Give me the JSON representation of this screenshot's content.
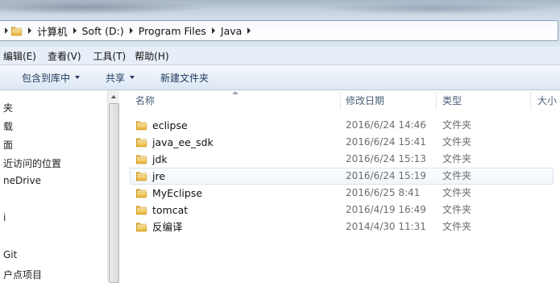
{
  "address": {
    "crumbs": [
      "计算机",
      "Soft (D:)",
      "Program Files",
      "Java"
    ]
  },
  "menubar": [
    "编辑(E)",
    "查看(V)",
    "工具(T)",
    "帮助(H)"
  ],
  "commandbar": {
    "include_in_library": "包含到库中",
    "share": "共享",
    "new_folder": "新建文件夹"
  },
  "navpane": [
    "夹",
    "载",
    "面",
    "近访问的位置",
    "neDrive",
    "i",
    "Git",
    "户点项目"
  ],
  "columns": {
    "name": "名称",
    "date_modified": "修改日期",
    "type": "类型",
    "size": "大小"
  },
  "files": [
    {
      "name": "eclipse",
      "date": "2016/6/24 14:46",
      "type": "文件夹"
    },
    {
      "name": "java_ee_sdk",
      "date": "2016/6/24 15:41",
      "type": "文件夹"
    },
    {
      "name": "jdk",
      "date": "2016/6/24 15:13",
      "type": "文件夹"
    },
    {
      "name": "jre",
      "date": "2016/6/24 15:19",
      "type": "文件夹"
    },
    {
      "name": "MyEclipse",
      "date": "2016/6/25 8:41",
      "type": "文件夹"
    },
    {
      "name": "tomcat",
      "date": "2016/4/19 16:49",
      "type": "文件夹"
    },
    {
      "name": "反编译",
      "date": "2014/4/30 11:31",
      "type": "文件夹"
    }
  ],
  "colors": {
    "folder": "#e8b73a",
    "command_text": "#1e395b",
    "header_text": "#4c607a"
  }
}
